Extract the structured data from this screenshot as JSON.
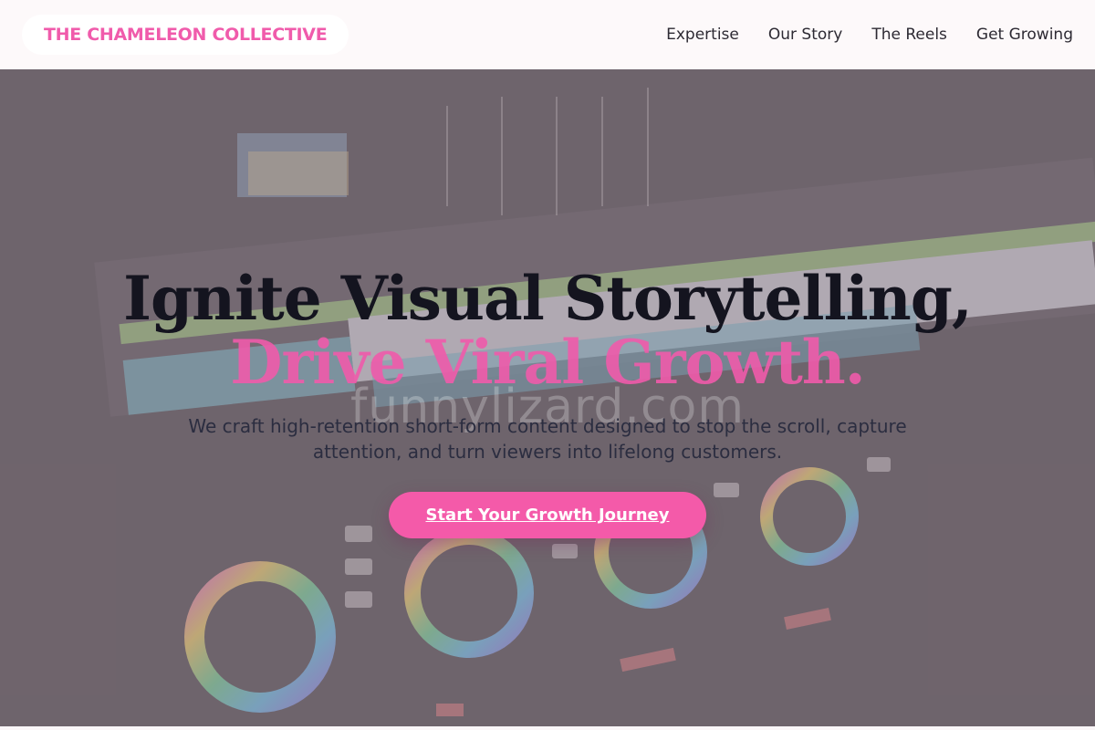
{
  "header": {
    "brand": "THE CHAMELEON COLLECTIVE",
    "nav": [
      "Expertise",
      "Our Story",
      "The Reels",
      "Get Growing"
    ]
  },
  "hero": {
    "headline_line1": "Ignite Visual Storytelling,",
    "headline_line2": "Drive Viral Growth.",
    "subtitle": "We craft high-retention short-form content designed to stop the scroll, capture attention, and turn viewers into lifelong customers.",
    "cta_label": "Start Your Growth Journey",
    "watermark": "funnylizard.com",
    "background_image": "video-color-grading-editor-screenshot"
  },
  "colors": {
    "accent": "#f05bab",
    "headline": "#14141f",
    "overlay": "#968891"
  }
}
